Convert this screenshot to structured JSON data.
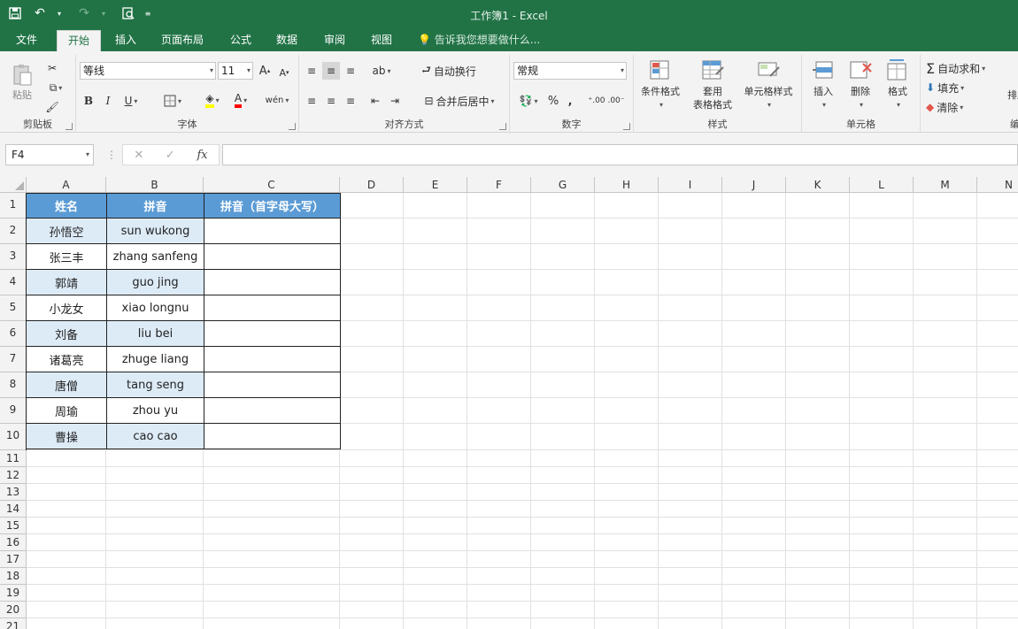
{
  "window": {
    "title": "工作簿1 - Excel"
  },
  "tabs": [
    "文件",
    "开始",
    "插入",
    "页面布局",
    "公式",
    "数据",
    "审阅",
    "视图"
  ],
  "active_tab": "开始",
  "tell_me": "告诉我您想要做什么...",
  "ribbon": {
    "clipboard": {
      "paste": "粘贴",
      "label": "剪贴板"
    },
    "font": {
      "name": "等线",
      "size": "11",
      "label": "字体",
      "bold": "B",
      "italic": "I",
      "underline": "U",
      "grow": "A",
      "shrink": "A",
      "font_color": "A",
      "pinyin": "wén"
    },
    "alignment": {
      "wrap": "自动换行",
      "merge": "合并后居中",
      "label": "对齐方式"
    },
    "number": {
      "format": "常规",
      "percent": "%",
      "comma": ",",
      "label": "数字"
    },
    "styles": {
      "conditional": "条件格式",
      "table_line1": "套用",
      "table_line2": "表格格式",
      "cell_styles": "单元格样式",
      "label": "样式"
    },
    "cells": {
      "insert": "插入",
      "delete": "删除",
      "format": "格式",
      "label": "单元格"
    },
    "editing": {
      "autosum": "自动求和",
      "fill": "填充",
      "clear": "清除",
      "sort": "排序",
      "label": "编"
    }
  },
  "formula_bar": {
    "name_box": "F4",
    "cancel": "✕",
    "enter": "✓",
    "fx": "fx",
    "value": ""
  },
  "columns": [
    "A",
    "B",
    "C",
    "D",
    "E",
    "F",
    "G",
    "H",
    "I",
    "J",
    "K",
    "L",
    "M",
    "N"
  ],
  "rows": [
    "1",
    "2",
    "3",
    "4",
    "5",
    "6",
    "7",
    "8",
    "9",
    "10",
    "11",
    "12",
    "13",
    "14",
    "15",
    "16",
    "17",
    "18",
    "19",
    "20",
    "21"
  ],
  "table": {
    "headers": [
      "姓名",
      "拼音",
      "拼音（首字母大写）"
    ],
    "rows": [
      [
        "孙悟空",
        "sun wukong",
        ""
      ],
      [
        "张三丰",
        "zhang sanfeng",
        ""
      ],
      [
        "郭靖",
        "guo jing",
        ""
      ],
      [
        "小龙女",
        "xiao longnu",
        ""
      ],
      [
        "刘备",
        "liu bei",
        ""
      ],
      [
        "诸葛亮",
        "zhuge liang",
        ""
      ],
      [
        "唐僧",
        "tang seng",
        ""
      ],
      [
        "周瑜",
        "zhou yu",
        ""
      ],
      [
        "曹操",
        "cao cao",
        ""
      ]
    ]
  },
  "colors": {
    "excel_green": "#217346",
    "header_fill": "#5b9bd5",
    "band_fill": "#ddebf7"
  }
}
